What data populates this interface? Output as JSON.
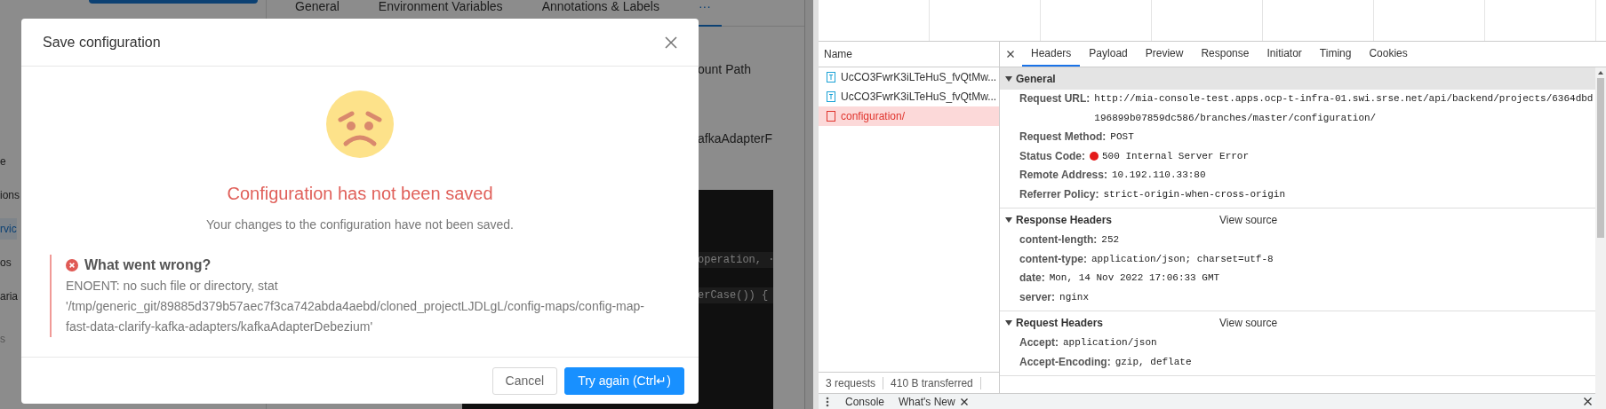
{
  "app": {
    "sidebar": [
      {
        "text": "e",
        "kind": "item",
        "selected": false
      },
      {
        "text": "ions",
        "kind": "item",
        "selected": false
      },
      {
        "text": "rvic",
        "kind": "item",
        "selected": true
      },
      {
        "text": "os",
        "kind": "item",
        "selected": false
      },
      {
        "text": "aria",
        "kind": "item",
        "selected": false
      },
      {
        "text": "s",
        "kind": "heading",
        "selected": false
      }
    ],
    "tabs": [
      {
        "label": "General",
        "selected": false
      },
      {
        "label": "Environment Variables",
        "selected": false
      },
      {
        "label": "Annotations & Labels",
        "selected": false
      },
      {
        "label": "···",
        "selected": true
      }
    ],
    "fragments": [
      "ount Path",
      "afkaAdapterF"
    ],
    "code_lines": [
      "operation, ·",
      "erCase()) {"
    ]
  },
  "modal": {
    "title": "Save configuration",
    "heading": "Configuration has not been saved",
    "message": "Your changes to the configuration have not been saved.",
    "error": {
      "title": "What went wrong?",
      "text": "ENOENT: no such file or directory, stat '/tmp/generic_git/89885d379b57aec7f3ca742abda4aebd/cloned_projectLJDLgL/config-maps/config-map-fast-data-clarify-kafka-adapters/kafkaAdapterDebezium'"
    },
    "buttons": [
      {
        "label": "Cancel",
        "kind": "secondary"
      },
      {
        "label": "Try again (Ctrl↵)",
        "kind": "primary"
      }
    ]
  },
  "devtools": {
    "requests_header": "Name",
    "requests": [
      {
        "name": "UcCO3FwrK3iLTeHuS_fvQtMw...",
        "kind": "document",
        "selected": false
      },
      {
        "name": "UcCO3FwrK3iLTeHuS_fvQtMw...",
        "kind": "document",
        "selected": false
      },
      {
        "name": "configuration/",
        "kind": "error",
        "selected": true
      }
    ],
    "summary": [
      "3 requests",
      "410 B transferred"
    ],
    "tabs": [
      {
        "label": "Headers",
        "selected": true
      },
      {
        "label": "Payload",
        "selected": false
      },
      {
        "label": "Preview",
        "selected": false
      },
      {
        "label": "Response",
        "selected": false
      },
      {
        "label": "Initiator",
        "selected": false
      },
      {
        "label": "Timing",
        "selected": false
      },
      {
        "label": "Cookies",
        "selected": false
      }
    ],
    "sections": [
      {
        "title": "General",
        "expanded": true,
        "highlighted": true,
        "rows": [
          {
            "name": "Request URL:",
            "value": "http://mia-console-test.apps.ocp-t-infra-01.swi.srse.net/api/backend/projects/6364dbd196899b07859dc586/branches/master/configuration/",
            "kind": "text"
          },
          {
            "name": "Request Method:",
            "value": "POST",
            "kind": "text"
          },
          {
            "name": "Status Code:",
            "value": "500 Internal Server Error",
            "kind": "status"
          },
          {
            "name": "Remote Address:",
            "value": "10.192.110.33:80",
            "kind": "text"
          },
          {
            "name": "Referrer Policy:",
            "value": "strict-origin-when-cross-origin",
            "kind": "text"
          }
        ]
      },
      {
        "title": "Response Headers",
        "expanded": true,
        "highlighted": false,
        "view_source": "View source",
        "rows": [
          {
            "name": "content-length:",
            "value": "252",
            "kind": "text"
          },
          {
            "name": "content-type:",
            "value": "application/json; charset=utf-8",
            "kind": "text"
          },
          {
            "name": "date:",
            "value": "Mon, 14 Nov 2022 17:06:33 GMT",
            "kind": "text"
          },
          {
            "name": "server:",
            "value": "nginx",
            "kind": "text"
          }
        ]
      },
      {
        "title": "Request Headers",
        "expanded": true,
        "highlighted": false,
        "view_source": "View source",
        "rows": [
          {
            "name": "Accept:",
            "value": "application/json",
            "kind": "text"
          },
          {
            "name": "Accept-Encoding:",
            "value": "gzip, deflate",
            "kind": "text"
          }
        ]
      }
    ],
    "drawer_tabs": [
      {
        "label": "Console",
        "closable": false
      },
      {
        "label": "What's New",
        "closable": true
      }
    ]
  }
}
